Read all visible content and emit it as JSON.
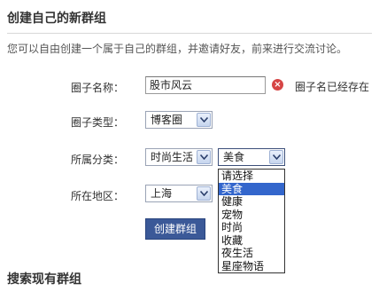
{
  "page_title": "创建自己的新群组",
  "intro": "您可以自由创建一个属于自己的群组，并邀请好友，前来进行交流讨论。",
  "form": {
    "name_label": "圈子名称：",
    "name_value": "股市风云",
    "name_error": "圈子名已经存在",
    "type_label": "圈子类型：",
    "type_value": "博客圈",
    "category_label": "所属分类：",
    "category_main_value": "时尚生活",
    "category_sub_value": "美食",
    "region_label": "所在地区：",
    "region_value": "上海",
    "submit_label": "创建群组"
  },
  "category_sub_options": [
    "请选择",
    "美食",
    "健康",
    "宠物",
    "时尚",
    "收藏",
    "夜生活",
    "星座物语"
  ],
  "category_sub_selected_index": 1,
  "search_section_title": "搜索现有群组",
  "colors": {
    "button_bg": "#3b5998",
    "selected_option_bg": "#3366cc",
    "error_icon": "#d64545"
  },
  "icons": {
    "error": "error-circle-icon",
    "dropdown": "chevron-down-icon"
  }
}
